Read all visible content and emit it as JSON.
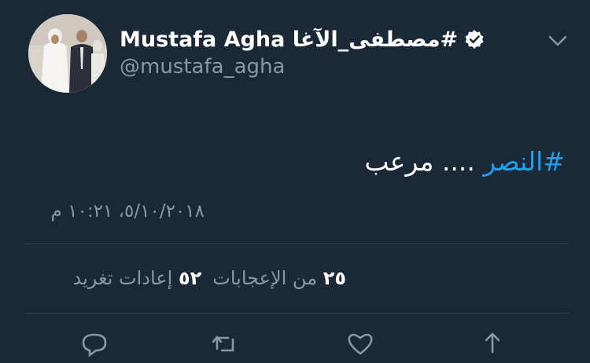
{
  "user": {
    "display_name": "Mustafa Agha مصطفى_الآغا#",
    "handle": "@mustafa_agha",
    "verified": true
  },
  "tweet": {
    "hashtag": "#النصر",
    "text": " .... مرعب",
    "timestamp": "٥/١٠/٢٠١٨، ١٠:٢١ م"
  },
  "stats": {
    "likes_count": "٢٥",
    "likes_label": "من الإعجابات",
    "retweets_count": "٥٢",
    "retweets_label": "إعادات تغريد"
  },
  "colors": {
    "background": "#1b2836",
    "accent": "#1da1f2",
    "secondary_text": "#8899a6",
    "divider": "#38444d"
  },
  "icons": [
    "verified-badge-icon",
    "chevron-down-icon",
    "reply-icon",
    "retweet-icon",
    "like-icon",
    "share-icon"
  ]
}
